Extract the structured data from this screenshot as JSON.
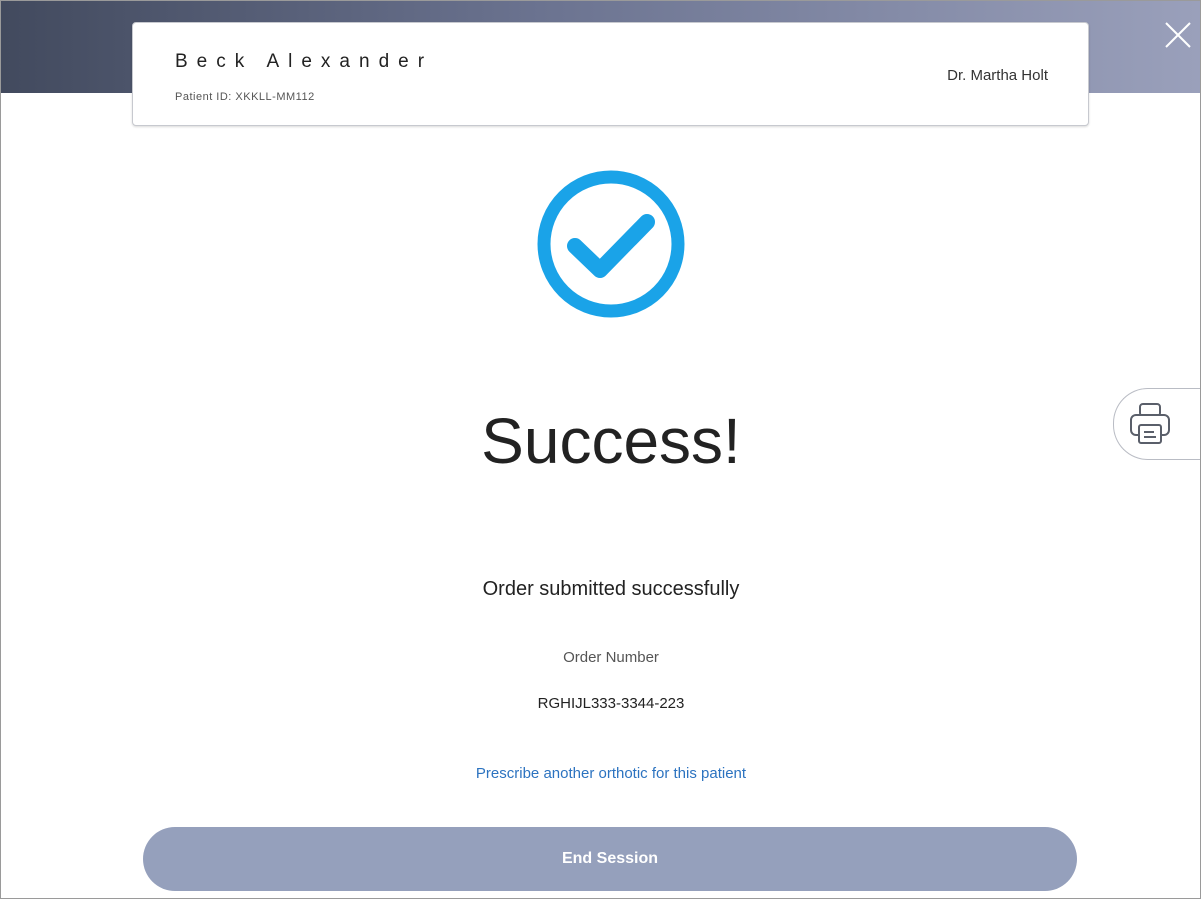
{
  "header": {
    "patient_name": "Beck Alexander",
    "patient_id": "Patient ID: XKKLL-MM112",
    "doctor_name": "Dr. Martha Holt"
  },
  "icons": {
    "close": "close-icon",
    "success_check": "check-circle-icon",
    "print": "printer-icon"
  },
  "main": {
    "title": "Success!",
    "message": "Order submitted successfully",
    "order_number_label": "Order Number",
    "order_number": "RGHIJL333-3344-223",
    "prescribe_link": "Prescribe another orthotic for this patient",
    "end_session_label": "End Session"
  },
  "colors": {
    "accent_blue": "#1aa3e8",
    "link_blue": "#2c73c0",
    "button_bg": "#95a0bc",
    "header_band": "#424a5e"
  }
}
